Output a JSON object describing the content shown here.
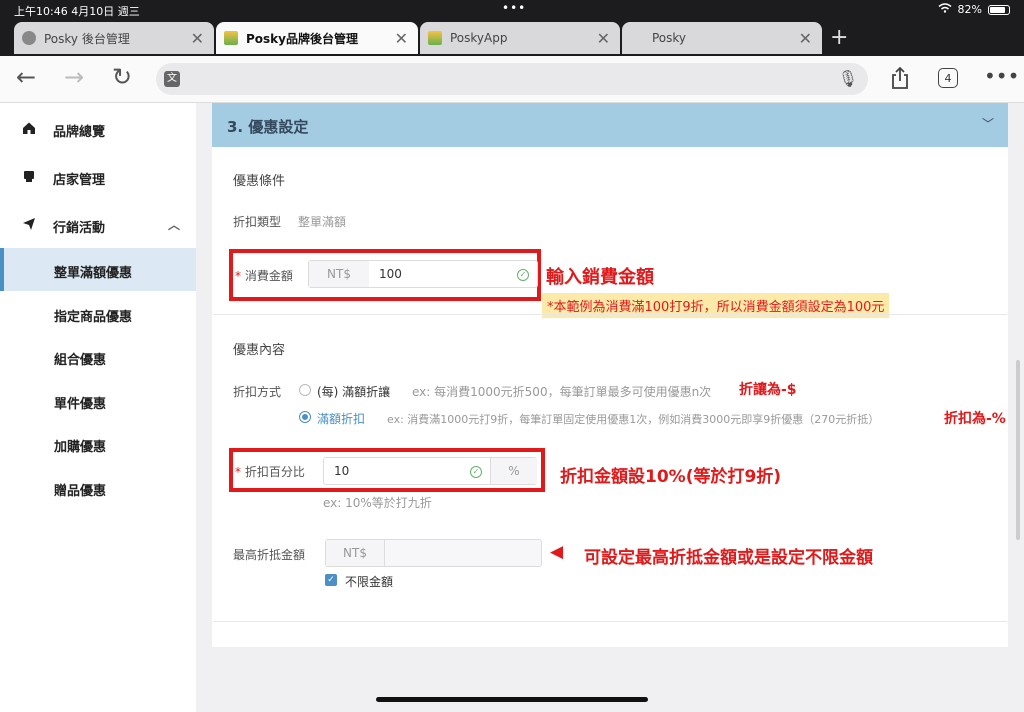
{
  "status_bar": {
    "time": "上午10:46  4月10日 週三",
    "battery": "82%",
    "battery_level": 0.82
  },
  "browser": {
    "tabs": [
      {
        "title": "Posky 後台管理",
        "active": false
      },
      {
        "title": "Posky品牌後台管理",
        "active": true
      },
      {
        "title": "PoskyApp",
        "active": false
      },
      {
        "title": "Posky",
        "active": false
      }
    ],
    "tab_count": "4",
    "icons": [
      "back-icon",
      "forward-icon",
      "reload-icon",
      "translate-icon",
      "mic-icon",
      "share-icon",
      "tabs-icon",
      "more-icon"
    ]
  },
  "sidebar": {
    "items": [
      {
        "label": "品牌總覽",
        "icon": "home-icon"
      },
      {
        "label": "店家管理",
        "icon": "store-icon"
      },
      {
        "label": "行銷活動",
        "icon": "send-icon",
        "expanded": true
      }
    ],
    "subitems": [
      {
        "label": "整單滿額優惠",
        "active": true
      },
      {
        "label": "指定商品優惠"
      },
      {
        "label": "組合優惠"
      },
      {
        "label": "單件優惠"
      },
      {
        "label": "加購優惠"
      },
      {
        "label": "贈品優惠"
      }
    ]
  },
  "section": {
    "title": "3. 優惠設定",
    "conditions": {
      "heading": "優惠條件",
      "discount_type_label": "折扣類型",
      "discount_type_value": "整單滿額",
      "amount_label": "消費金額",
      "amount_prefix": "NT$",
      "amount_value": "100"
    },
    "content": {
      "heading": "優惠內容",
      "method_label": "折扣方式",
      "option1_label": "(每) 滿額折讓",
      "option1_hint": "ex: 每消費1000元折500，每筆訂單最多可使用優惠n次",
      "option2_label": "滿額折扣",
      "option2_hint": "ex: 消費滿1000元打9折，每筆訂單固定使用優惠1次，例如消費3000元即享9折優惠（270元折抵）",
      "selected_option": 2,
      "percent_label": "折扣百分比",
      "percent_value": "10",
      "percent_suffix": "%",
      "percent_hint": "ex: 10%等於打九折",
      "max_label": "最高折抵金額",
      "max_prefix": "NT$",
      "max_value": "",
      "unlimited_label": "不限金額",
      "unlimited_checked": true
    }
  },
  "annotations": {
    "amount": "輸入銷費金額",
    "amount_note": "*本範例為消費滿100打9折，所以消費金額須設定為100元",
    "option1": "折讓為-$",
    "option2": "折扣為-%",
    "percent": "折扣金額設10%(等於打9折)",
    "max_arrow": "◀",
    "max": "可設定最高折抵金額或是設定不限金額"
  },
  "colors": {
    "accent": "#4a90c4",
    "header": "#a3cbe2",
    "annotation": "#e0191b",
    "highlight": "#fde9a8"
  }
}
